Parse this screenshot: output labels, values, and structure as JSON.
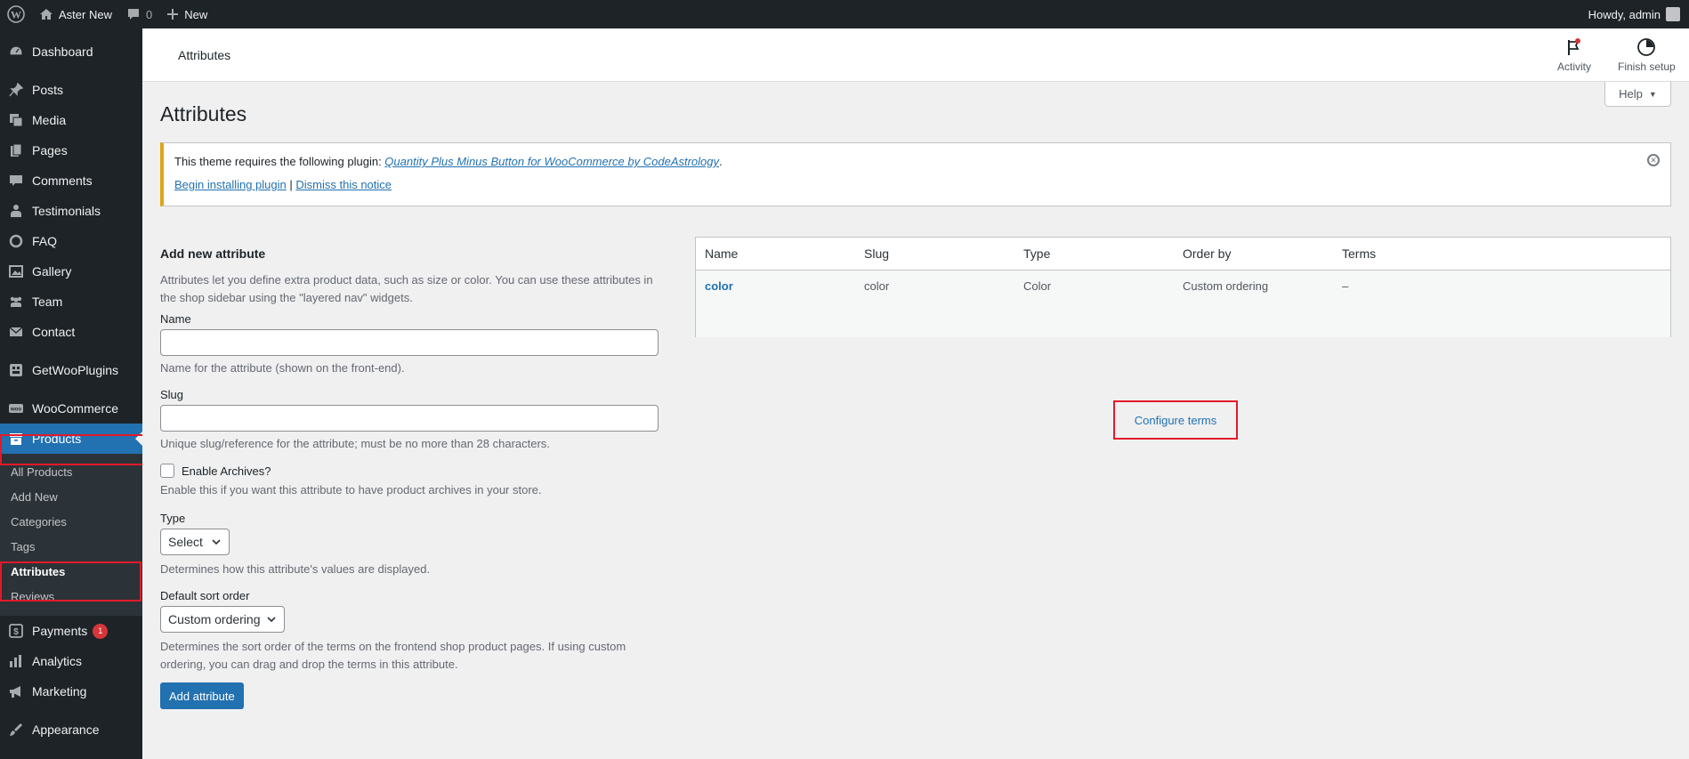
{
  "adminbar": {
    "site_name": "Aster New",
    "comments_count": "0",
    "new_label": "New",
    "howdy": "Howdy, admin"
  },
  "sidebar": {
    "items": [
      {
        "label": "Dashboard",
        "icon": "dashboard-icon"
      },
      {
        "label": "Posts",
        "icon": "pin-icon"
      },
      {
        "label": "Media",
        "icon": "media-icon"
      },
      {
        "label": "Pages",
        "icon": "pages-icon"
      },
      {
        "label": "Comments",
        "icon": "comment-icon"
      },
      {
        "label": "Testimonials",
        "icon": "person-icon"
      },
      {
        "label": "FAQ",
        "icon": "circle-icon"
      },
      {
        "label": "Gallery",
        "icon": "gallery-icon"
      },
      {
        "label": "Team",
        "icon": "team-icon"
      },
      {
        "label": "Contact",
        "icon": "mail-icon"
      },
      {
        "label": "GetWooPlugins",
        "icon": "plugin-icon"
      },
      {
        "label": "WooCommerce",
        "icon": "woo-icon"
      },
      {
        "label": "Products",
        "icon": "archive-icon"
      },
      {
        "label": "Payments",
        "icon": "dollar-icon",
        "badge": "1"
      },
      {
        "label": "Analytics",
        "icon": "chart-icon"
      },
      {
        "label": "Marketing",
        "icon": "megaphone-icon"
      },
      {
        "label": "Appearance",
        "icon": "brush-icon"
      }
    ],
    "submenu": [
      "All Products",
      "Add New",
      "Categories",
      "Tags",
      "Attributes",
      "Reviews"
    ]
  },
  "header": {
    "breadcrumb": "Attributes",
    "activity": "Activity",
    "finish_setup": "Finish setup"
  },
  "help_label": "Help",
  "page_title": "Attributes",
  "notice": {
    "prefix": "This theme requires the following plugin: ",
    "plugin_name": "Quantity Plus Minus Button for WooCommerce by CodeAstrology",
    "suffix": ".",
    "install": "Begin installing plugin",
    "sep": " | ",
    "dismiss": "Dismiss this notice"
  },
  "form": {
    "heading": "Add new attribute",
    "intro": "Attributes let you define extra product data, such as size or color. You can use these attributes in the shop sidebar using the \"layered nav\" widgets.",
    "name_label": "Name",
    "name_desc": "Name for the attribute (shown on the front-end).",
    "slug_label": "Slug",
    "slug_desc": "Unique slug/reference for the attribute; must be no more than 28 characters.",
    "archives_label": "Enable Archives?",
    "archives_desc": "Enable this if you want this attribute to have product archives in your store.",
    "type_label": "Type",
    "type_value": "Select",
    "type_desc": "Determines how this attribute's values are displayed.",
    "sort_label": "Default sort order",
    "sort_value": "Custom ordering",
    "sort_desc": "Determines the sort order of the terms on the frontend shop product pages. If using custom ordering, you can drag and drop the terms in this attribute.",
    "submit": "Add attribute"
  },
  "table": {
    "headers": [
      "Name",
      "Slug",
      "Type",
      "Order by",
      "Terms"
    ],
    "row": {
      "name": "color",
      "slug": "color",
      "type": "Color",
      "order_by": "Custom ordering",
      "terms": "–",
      "configure": "Configure terms"
    }
  }
}
